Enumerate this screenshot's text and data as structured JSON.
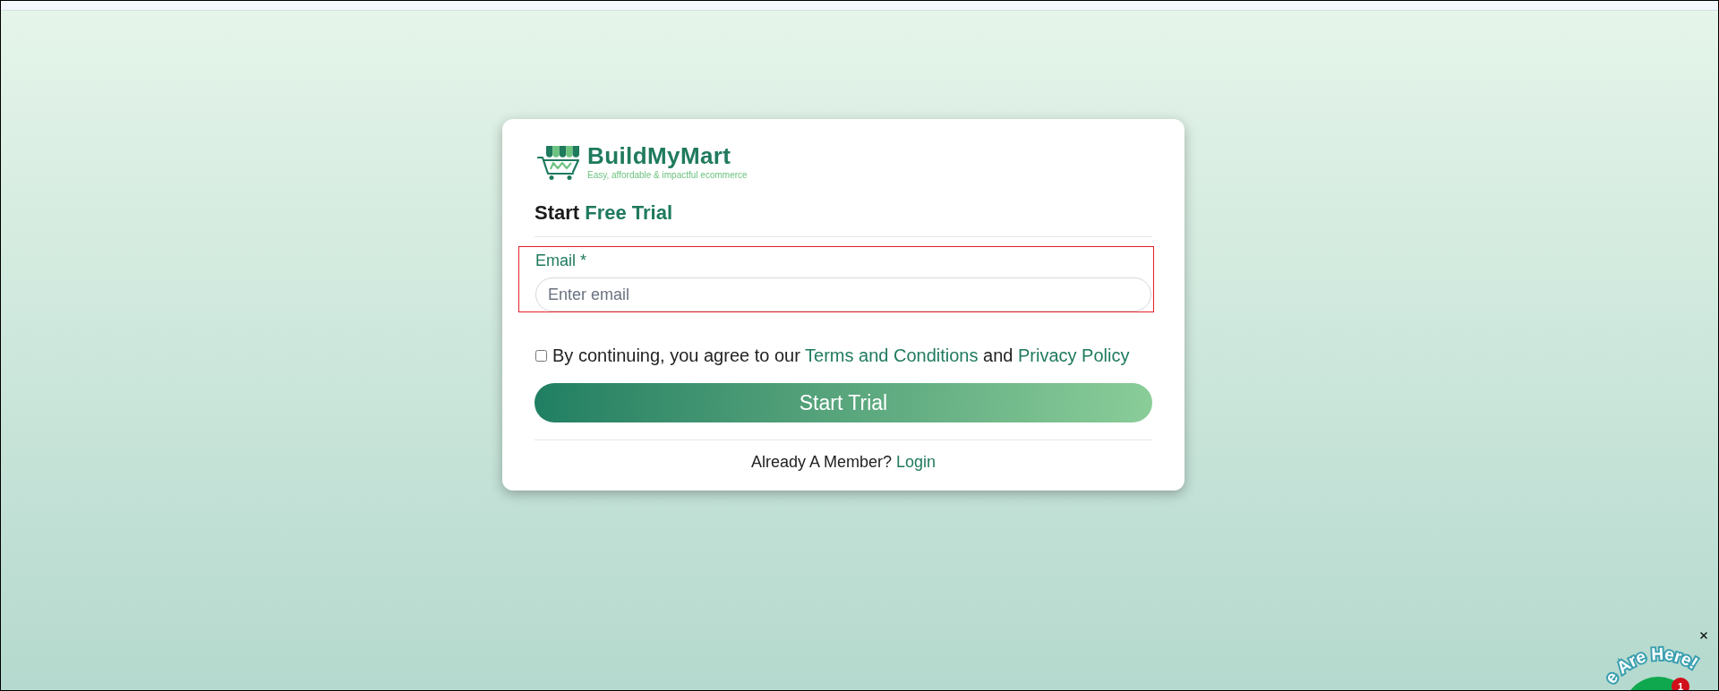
{
  "logo": {
    "name": "BuildMyMart",
    "tagline": "Easy, affordable & impactful ecommerce"
  },
  "heading": {
    "text": "Start",
    "accent": "Free Trial"
  },
  "email": {
    "label": "Email *",
    "placeholder": "Enter email",
    "highlighted": true
  },
  "consent": {
    "checked": false,
    "parts": [
      {
        "kind": "text",
        "text": "By continuing, you agree to our"
      },
      {
        "kind": "link",
        "text": "Terms and Conditions"
      },
      {
        "kind": "text",
        "text": "and"
      },
      {
        "kind": "link",
        "text": "Privacy Policy"
      }
    ]
  },
  "submit": {
    "label": "Start Trial"
  },
  "login": {
    "prompt": "Already A Member?",
    "link": "Login"
  },
  "chat_widget": {
    "text": "e Are Here!",
    "badge": "1"
  }
}
